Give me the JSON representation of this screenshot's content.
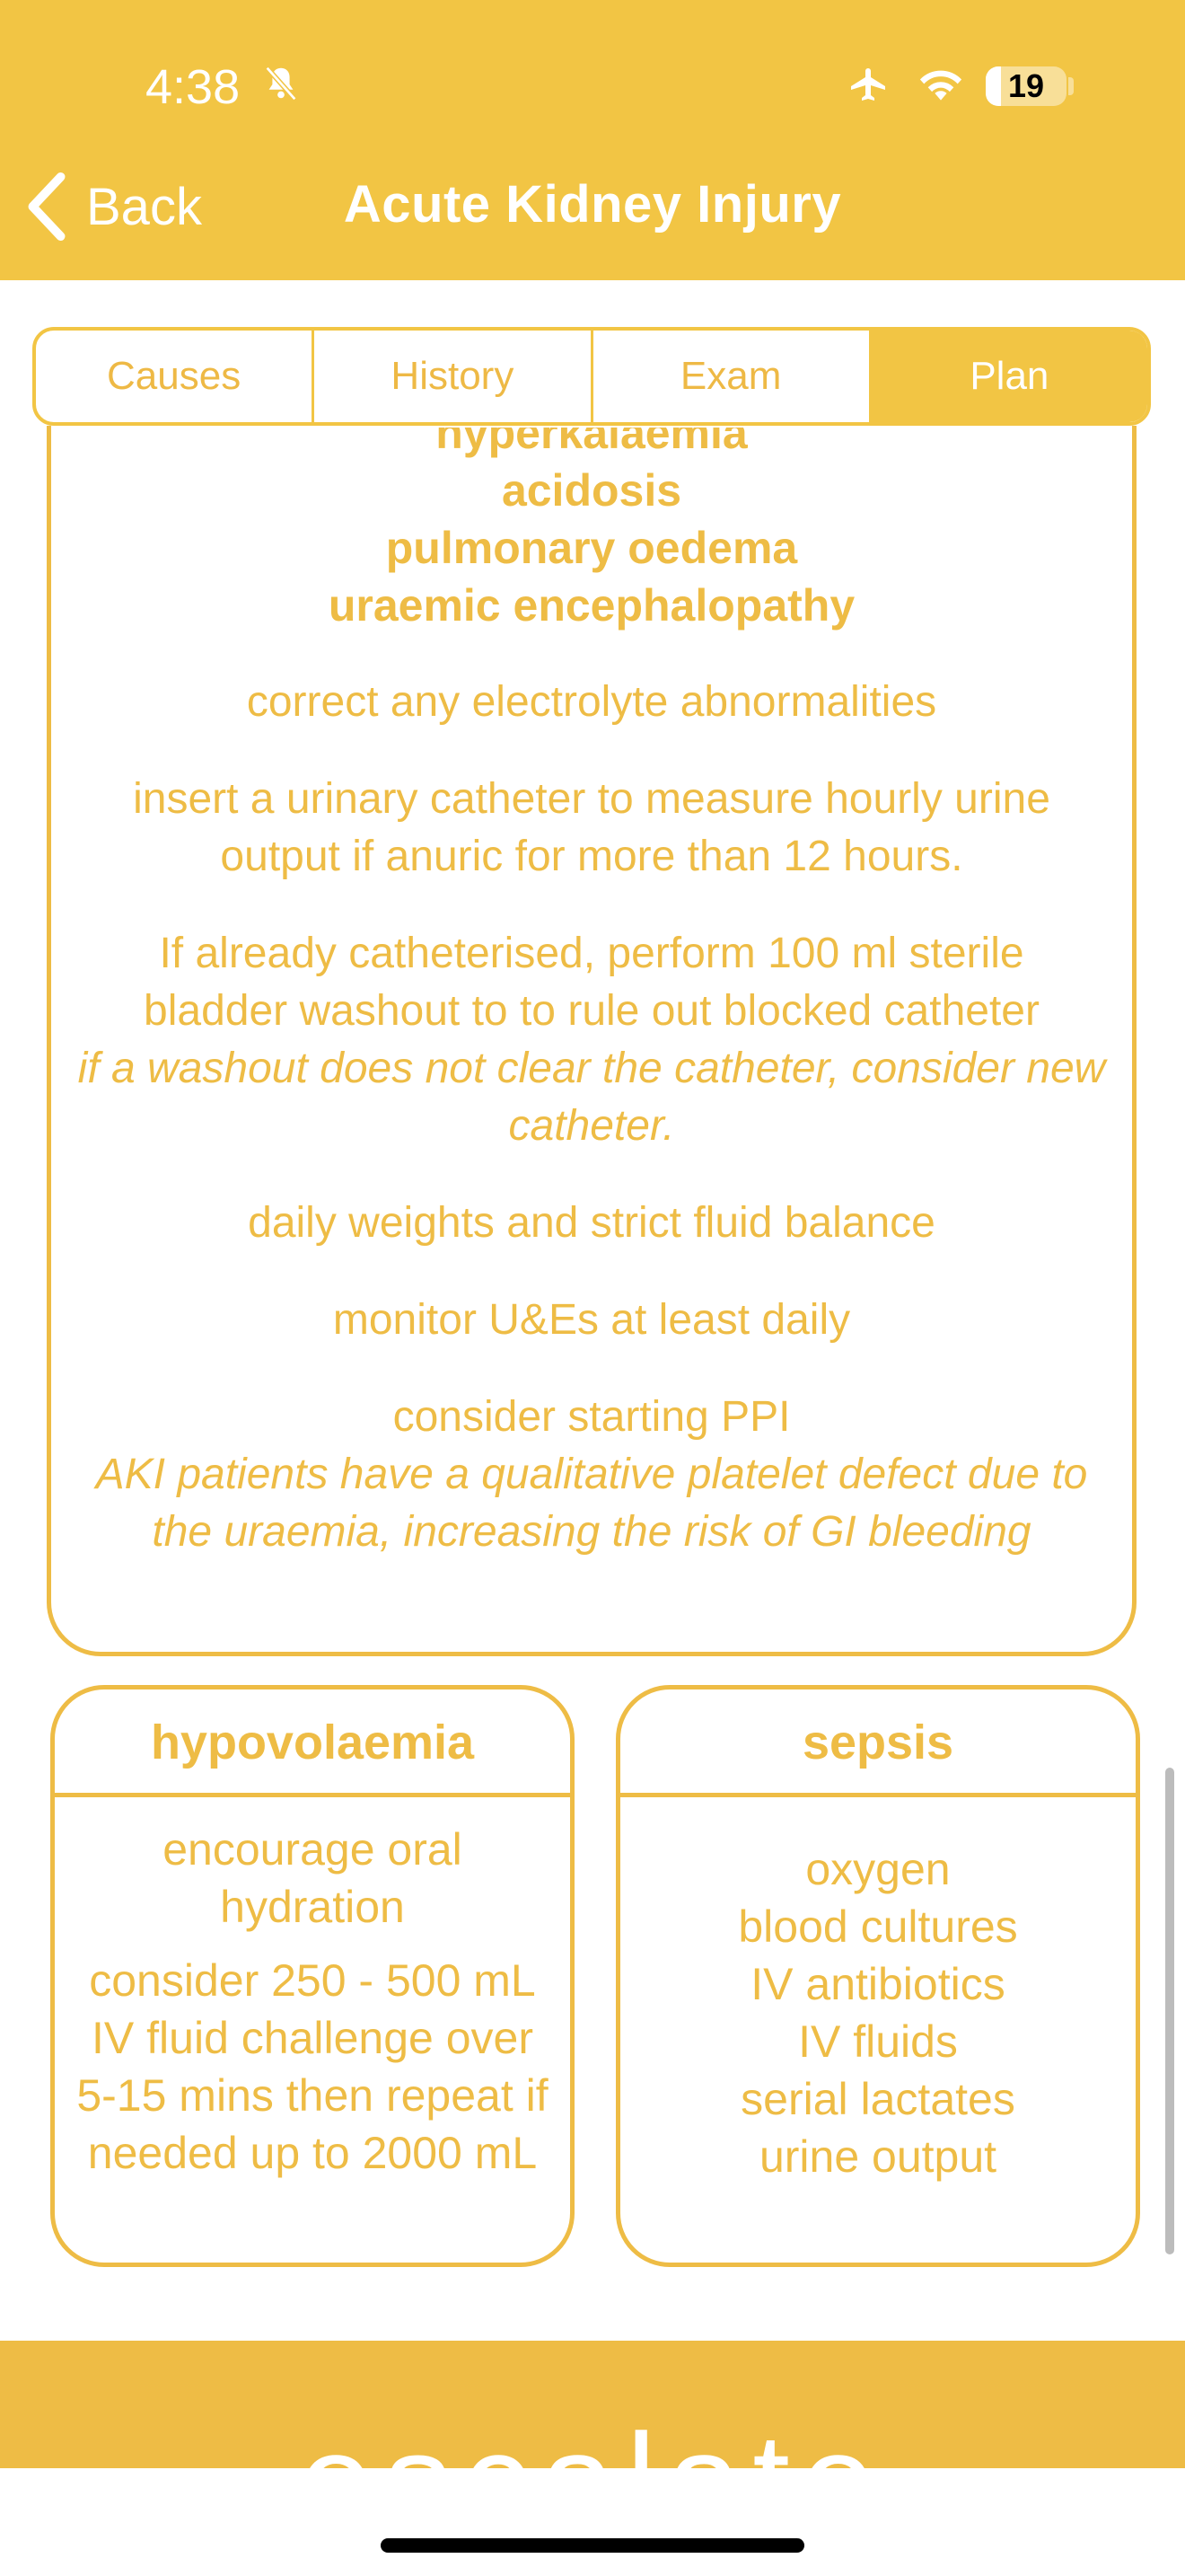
{
  "status_bar": {
    "time": "4:38",
    "battery_level": "19",
    "battery_fraction": 0.19
  },
  "nav": {
    "back_label": "Back",
    "title": "Acute Kidney Injury"
  },
  "tabs": [
    {
      "label": "Causes"
    },
    {
      "label": "History"
    },
    {
      "label": "Exam"
    },
    {
      "label": "Plan"
    }
  ],
  "active_tab": "Plan",
  "plan": {
    "indications": [
      "hyperkalaemia",
      "acidosis",
      "pulmonary oedema",
      "uraemic encephalopathy"
    ],
    "steps": [
      {
        "text": "correct any electrolyte abnormalities",
        "note": ""
      },
      {
        "text": "insert a urinary catheter to measure hourly urine output if anuric for more than 12 hours.",
        "note": ""
      },
      {
        "text": "If already catheterised, perform 100 ml sterile bladder washout to to rule out blocked catheter",
        "note": "if a washout does not clear the catheter, consider new catheter."
      },
      {
        "text": "daily weights and strict fluid balance",
        "note": ""
      },
      {
        "text": "monitor U&Es at least daily",
        "note": ""
      },
      {
        "text": "consider starting PPI",
        "note": "AKI patients have a qualitative platelet defect due to the uraemia, increasing the risk of GI bleeding"
      }
    ]
  },
  "hypovolaemia": {
    "title": "hypovolaemia",
    "items": [
      "encourage oral hydration",
      "consider 250 - 500 mL IV fluid challenge over 5-15 mins then repeat if needed up to 2000 mL"
    ]
  },
  "sepsis": {
    "title": "sepsis",
    "items": [
      "oxygen",
      "blood cultures",
      "IV antibiotics",
      "IV fluids",
      "serial lactates",
      "urine output"
    ]
  },
  "escalate": {
    "label": "escalate"
  },
  "colors": {
    "accent": "#F2C544",
    "text": "#EEBC45",
    "white": "#FFFFFF"
  }
}
